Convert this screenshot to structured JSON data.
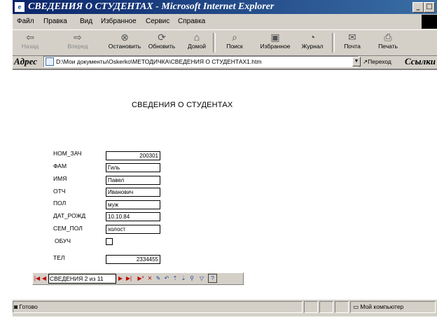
{
  "window": {
    "title": "СВЕДЕНИЯ О СТУДЕНТАХ  - Microsoft Internet Explorer",
    "minimize_glyph": "_",
    "maximize_glyph": "□"
  },
  "menu": [
    "Файл",
    "Правка",
    "Вид",
    "Избранное",
    "Сервис",
    "Справка"
  ],
  "toolbar": {
    "back": "Назад",
    "forward": "Вперед",
    "stop": "Остановить",
    "refresh": "Обновить",
    "home": "Домой",
    "search": "Поиск",
    "favorites": "Избранное",
    "history": "Журнал",
    "mail": "Почта",
    "print": "Печать"
  },
  "address": {
    "label": "Адрес",
    "url": "D:\\Мои документы\\Oskerko\\МЕТОДИЧКА\\СВЕДЕНИЯ О СТУДЕНТАХ1.htm",
    "go": "Переход",
    "links": "Ссылки"
  },
  "page": {
    "heading": "СВЕДЕНИЯ О СТУДЕНТАХ",
    "fields": [
      {
        "label": "НОМ_ЗАЧ",
        "value": "200301",
        "type": "number"
      },
      {
        "label": "ФАМ",
        "value": "Гиль",
        "type": "text"
      },
      {
        "label": "ИМЯ",
        "value": "Павел",
        "type": "text"
      },
      {
        "label": "ОТЧ",
        "value": "Иванович",
        "type": "text"
      },
      {
        "label": "ПОЛ",
        "value": "муж",
        "type": "text"
      },
      {
        "label": "ДАТ_РОЖД",
        "value": "10.10.84",
        "type": "text"
      },
      {
        "label": "СЕМ_ПОЛ",
        "value": "холост",
        "type": "text"
      },
      {
        "label": "ОБУЧ",
        "value": "",
        "type": "checkbox",
        "checked": false
      },
      {
        "label": "ТЕЛ",
        "value": "2334455",
        "type": "number"
      }
    ]
  },
  "record_nav": {
    "text": "СВЕДЕНИЯ 2 из 11"
  },
  "status": {
    "left": "Готово",
    "zone": "Мой компьютер"
  },
  "colors": {
    "titlebar_start": "#0a246a",
    "titlebar_end": "#3a6ea5",
    "chrome": "#d4d0c8",
    "nav_red": "#c00000"
  }
}
